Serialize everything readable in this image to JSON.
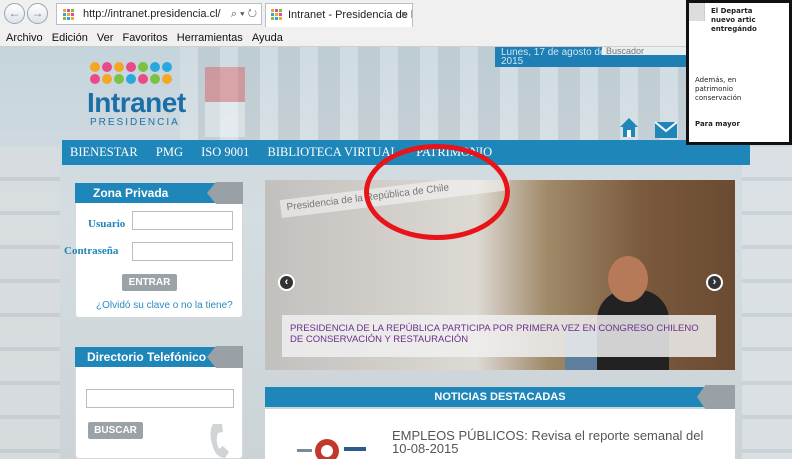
{
  "browser": {
    "url": "http://intranet.presidencia.cl/",
    "addr_controls": "⌕ ▾ ↻",
    "tab_title": "Intranet - Presidencia de la ...",
    "tab_close": "×",
    "back": "←",
    "forward": "→",
    "menu": [
      "Archivo",
      "Edición",
      "Ver",
      "Favoritos",
      "Herramientas",
      "Ayuda"
    ]
  },
  "site": {
    "logo_title": "Intranet",
    "logo_subtitle": "PRESIDENCIA",
    "date_line1": "Lunes, 17 de agosto de",
    "date_line2": "2015",
    "search_placeholder": "Buscador"
  },
  "nav": [
    "BIENESTAR",
    "PMG",
    "ISO 9001",
    "BIBLIOTECA VIRTUAL",
    "PATRIMONIO"
  ],
  "zona_privada": {
    "title": "Zona Privada",
    "usuario_label": "Usuario",
    "contrasena_label": "Contraseña",
    "enter_button": "ENTRAR",
    "forgot_link": "¿Olvidó su clave o no la tiene?"
  },
  "directorio": {
    "title": "Directorio Telefónico",
    "search_button": "BUSCAR"
  },
  "slider": {
    "banner_text": "Presidencia de la República de Chile",
    "prev": "‹",
    "next": "›",
    "caption": "PRESIDENCIA DE LA REPÚBLICA PARTICIPA POR PRIMERA VEZ EN CONGRESO CHILENO DE CONSERVACIÓN Y RESTAURACIÓN"
  },
  "news": {
    "header": "NOTICIAS DESTACADAS",
    "item_title": "EMPLEOS PÚBLICOS: Revisa el reporte semanal del 10-08-2015"
  },
  "popup": {
    "line1": "El Departa",
    "line2": "nuevo artic",
    "line3": "entregándo",
    "line4": "Además, en",
    "line5": "patrimonio",
    "line6": "conservación",
    "line7": "Para mayor"
  },
  "colors": {
    "nav_blue": "#1e86b8",
    "annotation_red": "#e8141a"
  }
}
